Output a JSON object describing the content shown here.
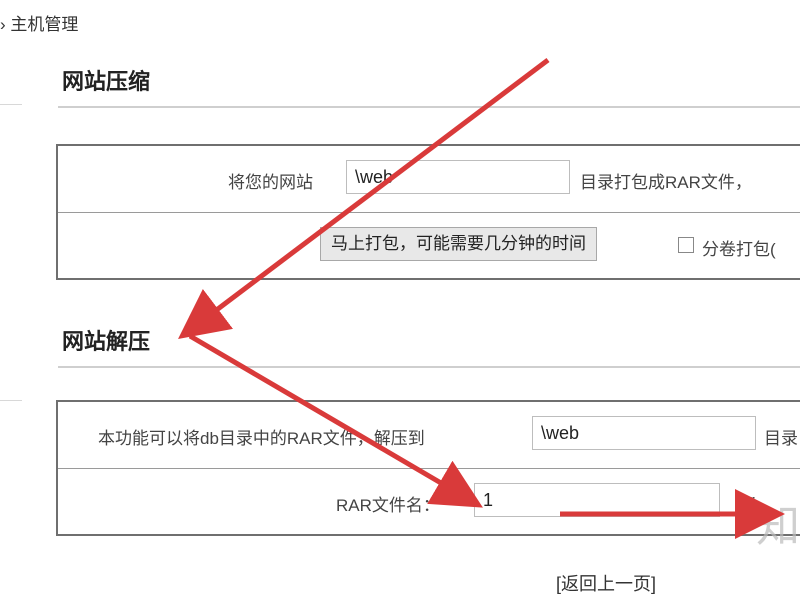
{
  "breadcrumb": {
    "text": "› 主机管理"
  },
  "compress": {
    "title": "网站压缩",
    "row1": {
      "label": "将您的网站",
      "value": "\\web",
      "suffix": "目录打包成RAR文件，"
    },
    "row2": {
      "button": "马上打包，可能需要几分钟的时间",
      "checkbox_label": "分卷打包("
    }
  },
  "extract": {
    "title": "网站解压",
    "row1": {
      "label": "本功能可以将db目录中的RAR文件，解压到",
      "value": "\\web",
      "suffix": "目录"
    },
    "row2": {
      "label": "RAR文件名：",
      "value": "1",
      "suffix": "rar"
    }
  },
  "footer": {
    "back_link": "[返回上一页]"
  },
  "watermark": {
    "text": "知"
  },
  "colors": {
    "arrow": "#d93a3a",
    "panel_border": "#6f6f6f",
    "button_bg": "#e8e8e8"
  },
  "icons": [
    "checkbox-icon",
    "red-arrow-annotation"
  ]
}
